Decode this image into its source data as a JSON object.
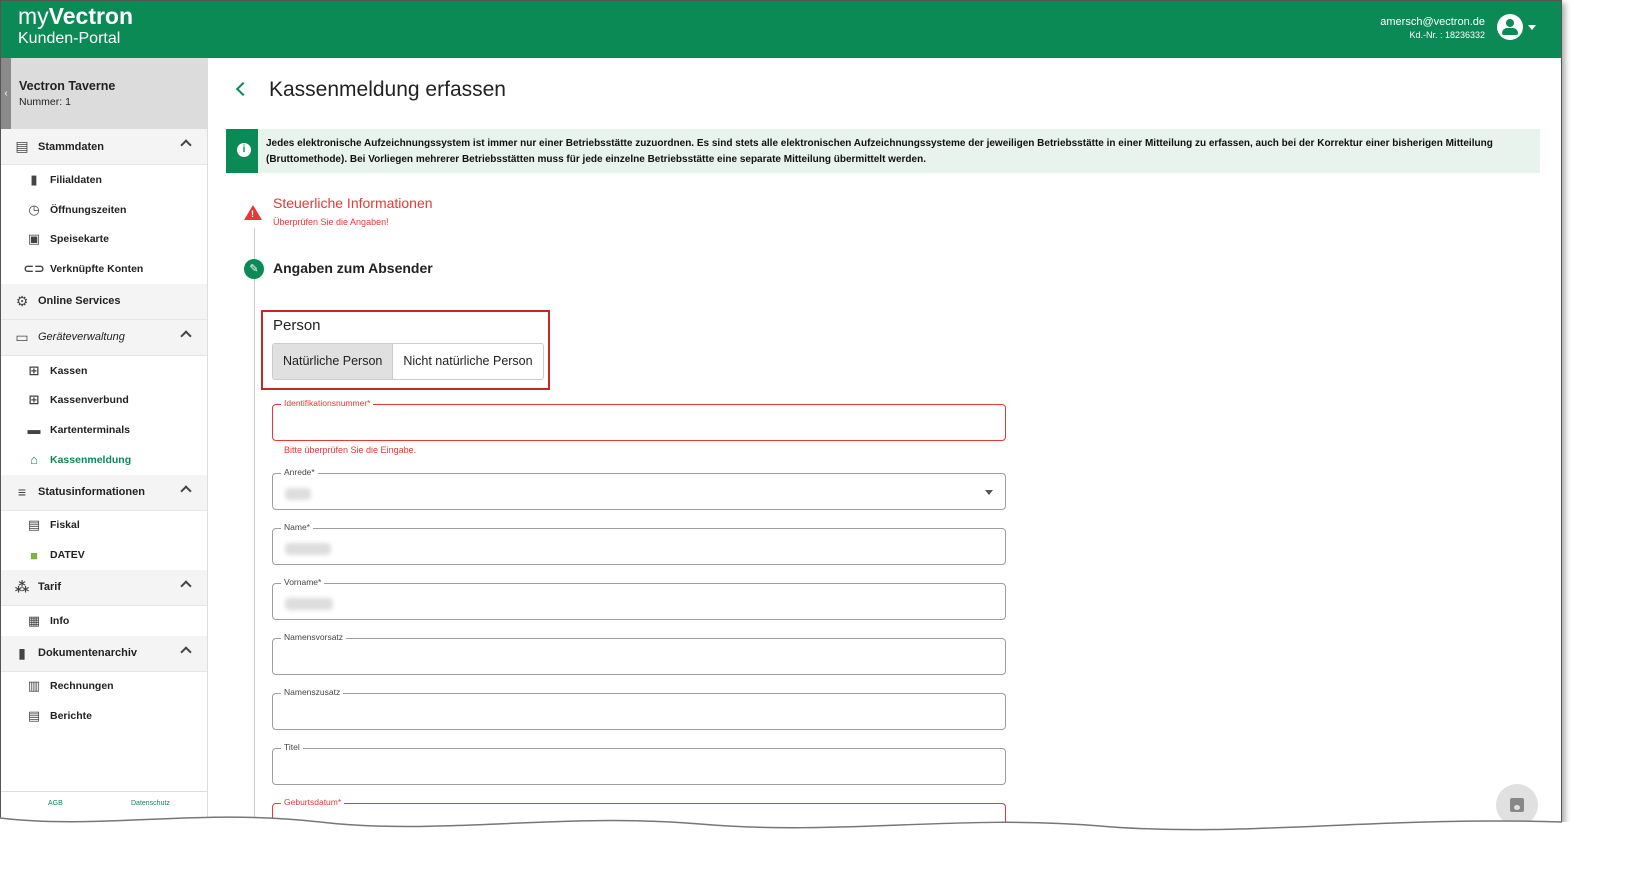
{
  "header": {
    "brand_my": "my",
    "brand_name": "Vectron",
    "brand_sub": "Kunden-Portal",
    "email": "amersch@vectron.de",
    "customer_no": "Kd.-Nr. : 18236332",
    "colors": {
      "primary": "#0b8a56",
      "error": "#e53935"
    }
  },
  "sidebar": {
    "store_name": "Vectron Taverne",
    "store_number": "Nummer: 1",
    "sections": {
      "stammdaten": "Stammdaten",
      "online": "Online Services",
      "geraete": "Geräteverwaltung",
      "status": "Statusinformationen",
      "tarif": "Tarif",
      "dokumente": "Dokumentenarchiv"
    },
    "items": {
      "filialdaten": "Filialdaten",
      "oeffnungszeiten": "Öffnungszeiten",
      "speisekarte": "Speisekarte",
      "konten": "Verknüpfte Konten",
      "kassen": "Kassen",
      "kassenverbund": "Kassenverbund",
      "kartenterminals": "Kartenterminals",
      "kassenmeldung": "Kassenmeldung",
      "fiskal": "Fiskal",
      "datev": "DATEV",
      "info": "Info",
      "rechnungen": "Rechnungen",
      "berichte": "Berichte"
    },
    "footer": {
      "agb": "AGB",
      "datenschutz": "Datenschutz"
    }
  },
  "main": {
    "title": "Kassenmeldung erfassen",
    "info_text": "Jedes elektronische Aufzeichnungssystem ist immer nur einer Betriebsstätte zuzuordnen. Es sind stets alle elektronischen Aufzeichnungssysteme der jeweiligen Betriebsstätte in einer Mitteilung zu erfassen, auch bei der Korrektur einer bisherigen Mitteilung (Bruttomethode). Bei Vorliegen mehrerer Betriebsstätten muss für jede einzelne Betriebsstätte eine separate Mitteilung übermittelt werden.",
    "step1_title": "Steuerliche Informationen",
    "step1_error": "Überprüfen Sie die Angaben!",
    "step2_title": "Angaben zum Absender",
    "person_label": "Person",
    "person_options": [
      "Natürliche Person",
      "Nicht natürliche Person"
    ],
    "fields": {
      "idnr": "Identifikationsnummer*",
      "idnr_error": "Bitte überprüfen Sie die Eingabe.",
      "anrede": "Anrede*",
      "name": "Name*",
      "vorname": "Vorname*",
      "namensvorsatz": "Namensvorsatz",
      "namenszusatz": "Namenszusatz",
      "titel": "Titel",
      "geburtsdatum": "Geburtsdatum*"
    }
  }
}
